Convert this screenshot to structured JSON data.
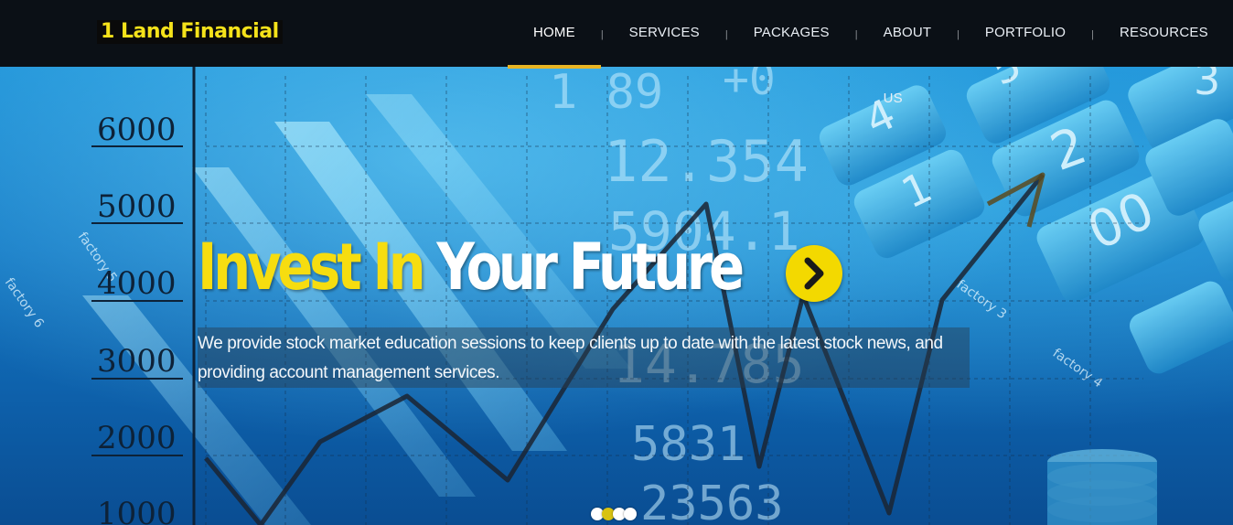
{
  "header": {
    "logo": "1 Land Financial",
    "nav": [
      {
        "label": "HOME",
        "active": true
      },
      {
        "label": "SERVICES",
        "active": false
      },
      {
        "label": "PACKAGES",
        "active": false
      },
      {
        "label": "ABOUT US",
        "active": false
      },
      {
        "label": "PORTFOLIO",
        "active": false
      },
      {
        "label": "RESOURCES",
        "active": false
      }
    ],
    "separator": "|"
  },
  "hero": {
    "title_highlight": "Invest In",
    "title_rest": "Your Future",
    "description_line1": "We provide stock market education sessions to keep clients up to date with the latest stock news, and",
    "description_line2": "providing account management services.",
    "arrow_icon": "chevron-right-icon",
    "slide_count": 4,
    "active_slide": 2
  },
  "background": {
    "axis_labels": [
      "6000",
      "5000",
      "4000",
      "3000",
      "2000",
      "1000"
    ],
    "ticker_numbers": [
      "1 89",
      "+0",
      "12.354",
      "5904.1",
      "14.785",
      "5831",
      "23563"
    ],
    "factory_labels": [
      "factory 6",
      "factory 5",
      "factory 3",
      "factory 4"
    ],
    "calculator_keys": [
      "4",
      "5",
      "3",
      "1",
      "2",
      "00"
    ]
  },
  "colors": {
    "accent_yellow": "#f6dd10",
    "nav_bg": "#0b1016",
    "active_underline": "#e8b423"
  }
}
